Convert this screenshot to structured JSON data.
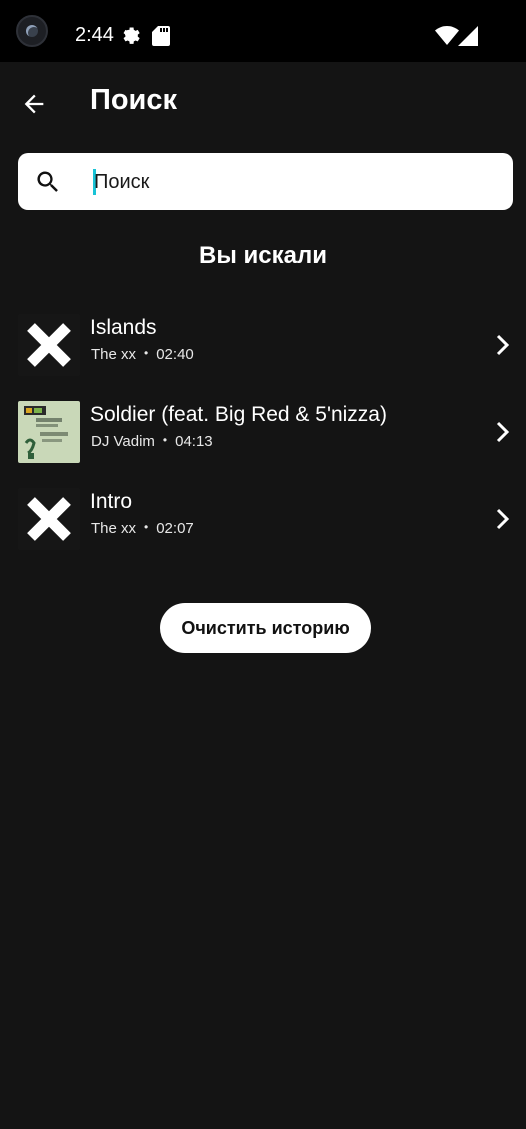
{
  "status_bar": {
    "time": "2:44",
    "icons": [
      "camera-icon",
      "gear-icon",
      "sd-card-icon",
      "wifi-icon",
      "signal-icon"
    ]
  },
  "header": {
    "title": "Поиск",
    "back_icon": "arrow-left-icon"
  },
  "search": {
    "placeholder": "Поиск",
    "value": ""
  },
  "history": {
    "title": "Вы искали",
    "items": [
      {
        "title": "Islands",
        "artist": "The xx",
        "duration": "02:40",
        "cover": "the-xx-cover"
      },
      {
        "title": "Soldier (feat. Big Red & 5'nizza)",
        "artist": "DJ Vadim",
        "duration": "04:13",
        "cover": "dj-vadim-cover"
      },
      {
        "title": "Intro",
        "artist": "The xx",
        "duration": "02:07",
        "cover": "the-xx-cover"
      }
    ],
    "separator": "•",
    "clear_label": "Очистить историю"
  },
  "colors": {
    "background": "#141414",
    "status_bar": "#000000",
    "search_bg": "#ffffff",
    "caret": "#19c3d6",
    "button_bg": "#ffffff"
  }
}
